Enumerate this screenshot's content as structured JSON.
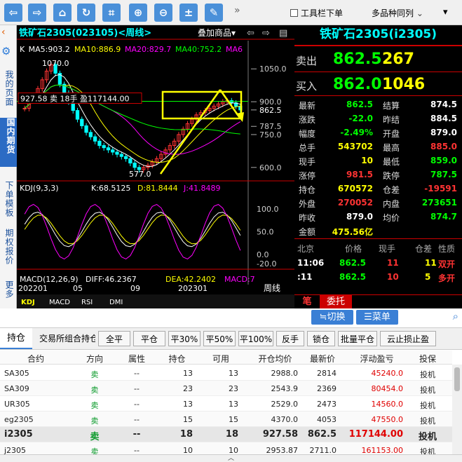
{
  "toolbar": {
    "gongju_label": "工具栏下单",
    "duo_label": "多品种同列"
  },
  "sidebar": {
    "items": [
      "我的页面",
      "国内期货",
      "下单模板",
      "期权报价",
      "更多"
    ]
  },
  "chart": {
    "title": "铁矿石2305(023105)<周线>",
    "overlay_label": "叠加商品▾",
    "ma": {
      "k": "K",
      "ma5": "MA5:903.2",
      "ma10": "MA10:886.9",
      "ma20": "MA20:829.7",
      "ma40": "MA40:752.2",
      "ma6": "MA6"
    },
    "price_scale": [
      "1050.0",
      "900.0",
      "862.5",
      "787.5",
      "750.0",
      "600.0"
    ],
    "high_label": "1070.0",
    "low_label": "577.0",
    "position_label": "927.58 卖 18手 盈117144.00",
    "kdj": {
      "name": "KDJ(9,3,3)",
      "k": "K:68.5125",
      "d": "D:81.8444",
      "j": "J:41.8489",
      "scale": [
        "100.0",
        "50.0",
        "0.0",
        "-20.0"
      ]
    },
    "macd": {
      "name": "MACD(12,26,9)",
      "diff": "DIFF:46.2367",
      "dea": "DEA:42.2402",
      "macd": "MACD:7"
    },
    "dates": [
      "202201",
      "05",
      "09",
      "202301"
    ],
    "period_label": "周线",
    "tabs": [
      "KDJ",
      "MACD",
      "RSI",
      "DMI"
    ],
    "colors": {
      "ma5": "#ffffff",
      "ma10": "#ffff00",
      "ma20": "#ff00ff",
      "ma40": "#00ff00",
      "up": "#ff3333",
      "down": "#00ffff"
    }
  },
  "quote": {
    "title": "铁矿石2305(i2305)",
    "sell": {
      "label": "卖出",
      "price": "862.5",
      "vol": "267"
    },
    "buy": {
      "label": "买入",
      "price": "862.0",
      "vol": "1046"
    },
    "rows": [
      [
        "最新",
        "862.5",
        "结算",
        "874.5"
      ],
      [
        "涨跌",
        "-22.0",
        "昨结",
        "884.5"
      ],
      [
        "幅度",
        "-2.49%",
        "开盘",
        "879.0"
      ],
      [
        "总手",
        "543702",
        "最高",
        "885.0"
      ],
      [
        "现手",
        "10",
        "最低",
        "859.0"
      ],
      [
        "涨停",
        "981.5",
        "跌停",
        "787.5"
      ],
      [
        "持仓",
        "670572",
        "仓差",
        "-19591"
      ],
      [
        "外盘",
        "270052",
        "内盘",
        "273651"
      ],
      [
        "昨收",
        "879.0",
        "均价",
        "874.7"
      ],
      [
        "金额",
        "475.56亿",
        "",
        ""
      ]
    ],
    "tick_header": [
      "北京",
      "价格",
      "现手",
      "仓差",
      "性质"
    ],
    "ticks": [
      [
        "11:06",
        "862.5",
        "11",
        "11",
        "双开"
      ],
      [
        ":11",
        "862.5",
        "10",
        "5",
        "多开"
      ]
    ],
    "tabs": [
      "笔",
      "委托"
    ]
  },
  "actions": {
    "switch_label": "≒切换",
    "menu_label": "☰菜单"
  },
  "bottom": {
    "tabs": [
      "持仓",
      "交易所组合持仓"
    ],
    "buttons": [
      "全平",
      "平仓",
      "平30%",
      "平50%",
      "平100%",
      "反手",
      "锁仓",
      "批量平仓",
      "云止损止盈"
    ],
    "headers": [
      "合约",
      "方向",
      "属性",
      "持仓",
      "可用",
      "开仓均价",
      "最新价",
      "浮动盈亏",
      "投保"
    ],
    "rows": [
      [
        "SA305",
        "卖",
        "--",
        "13",
        "13",
        "2988.0",
        "2814",
        "45240.0",
        "投机"
      ],
      [
        "SA309",
        "卖",
        "--",
        "23",
        "23",
        "2543.9",
        "2369",
        "80454.0",
        "投机"
      ],
      [
        "UR305",
        "卖",
        "--",
        "13",
        "13",
        "2529.0",
        "2473",
        "14560.0",
        "投机"
      ],
      [
        "eg2305",
        "卖",
        "--",
        "15",
        "15",
        "4370.0",
        "4053",
        "47550.0",
        "投机"
      ],
      [
        "i2305",
        "卖",
        "--",
        "18",
        "18",
        "927.58",
        "862.5",
        "117144.00",
        "投机"
      ],
      [
        "j2305",
        "卖",
        "--",
        "10",
        "10",
        "2953.87",
        "2711.0",
        "161153.00",
        "投机"
      ]
    ]
  }
}
